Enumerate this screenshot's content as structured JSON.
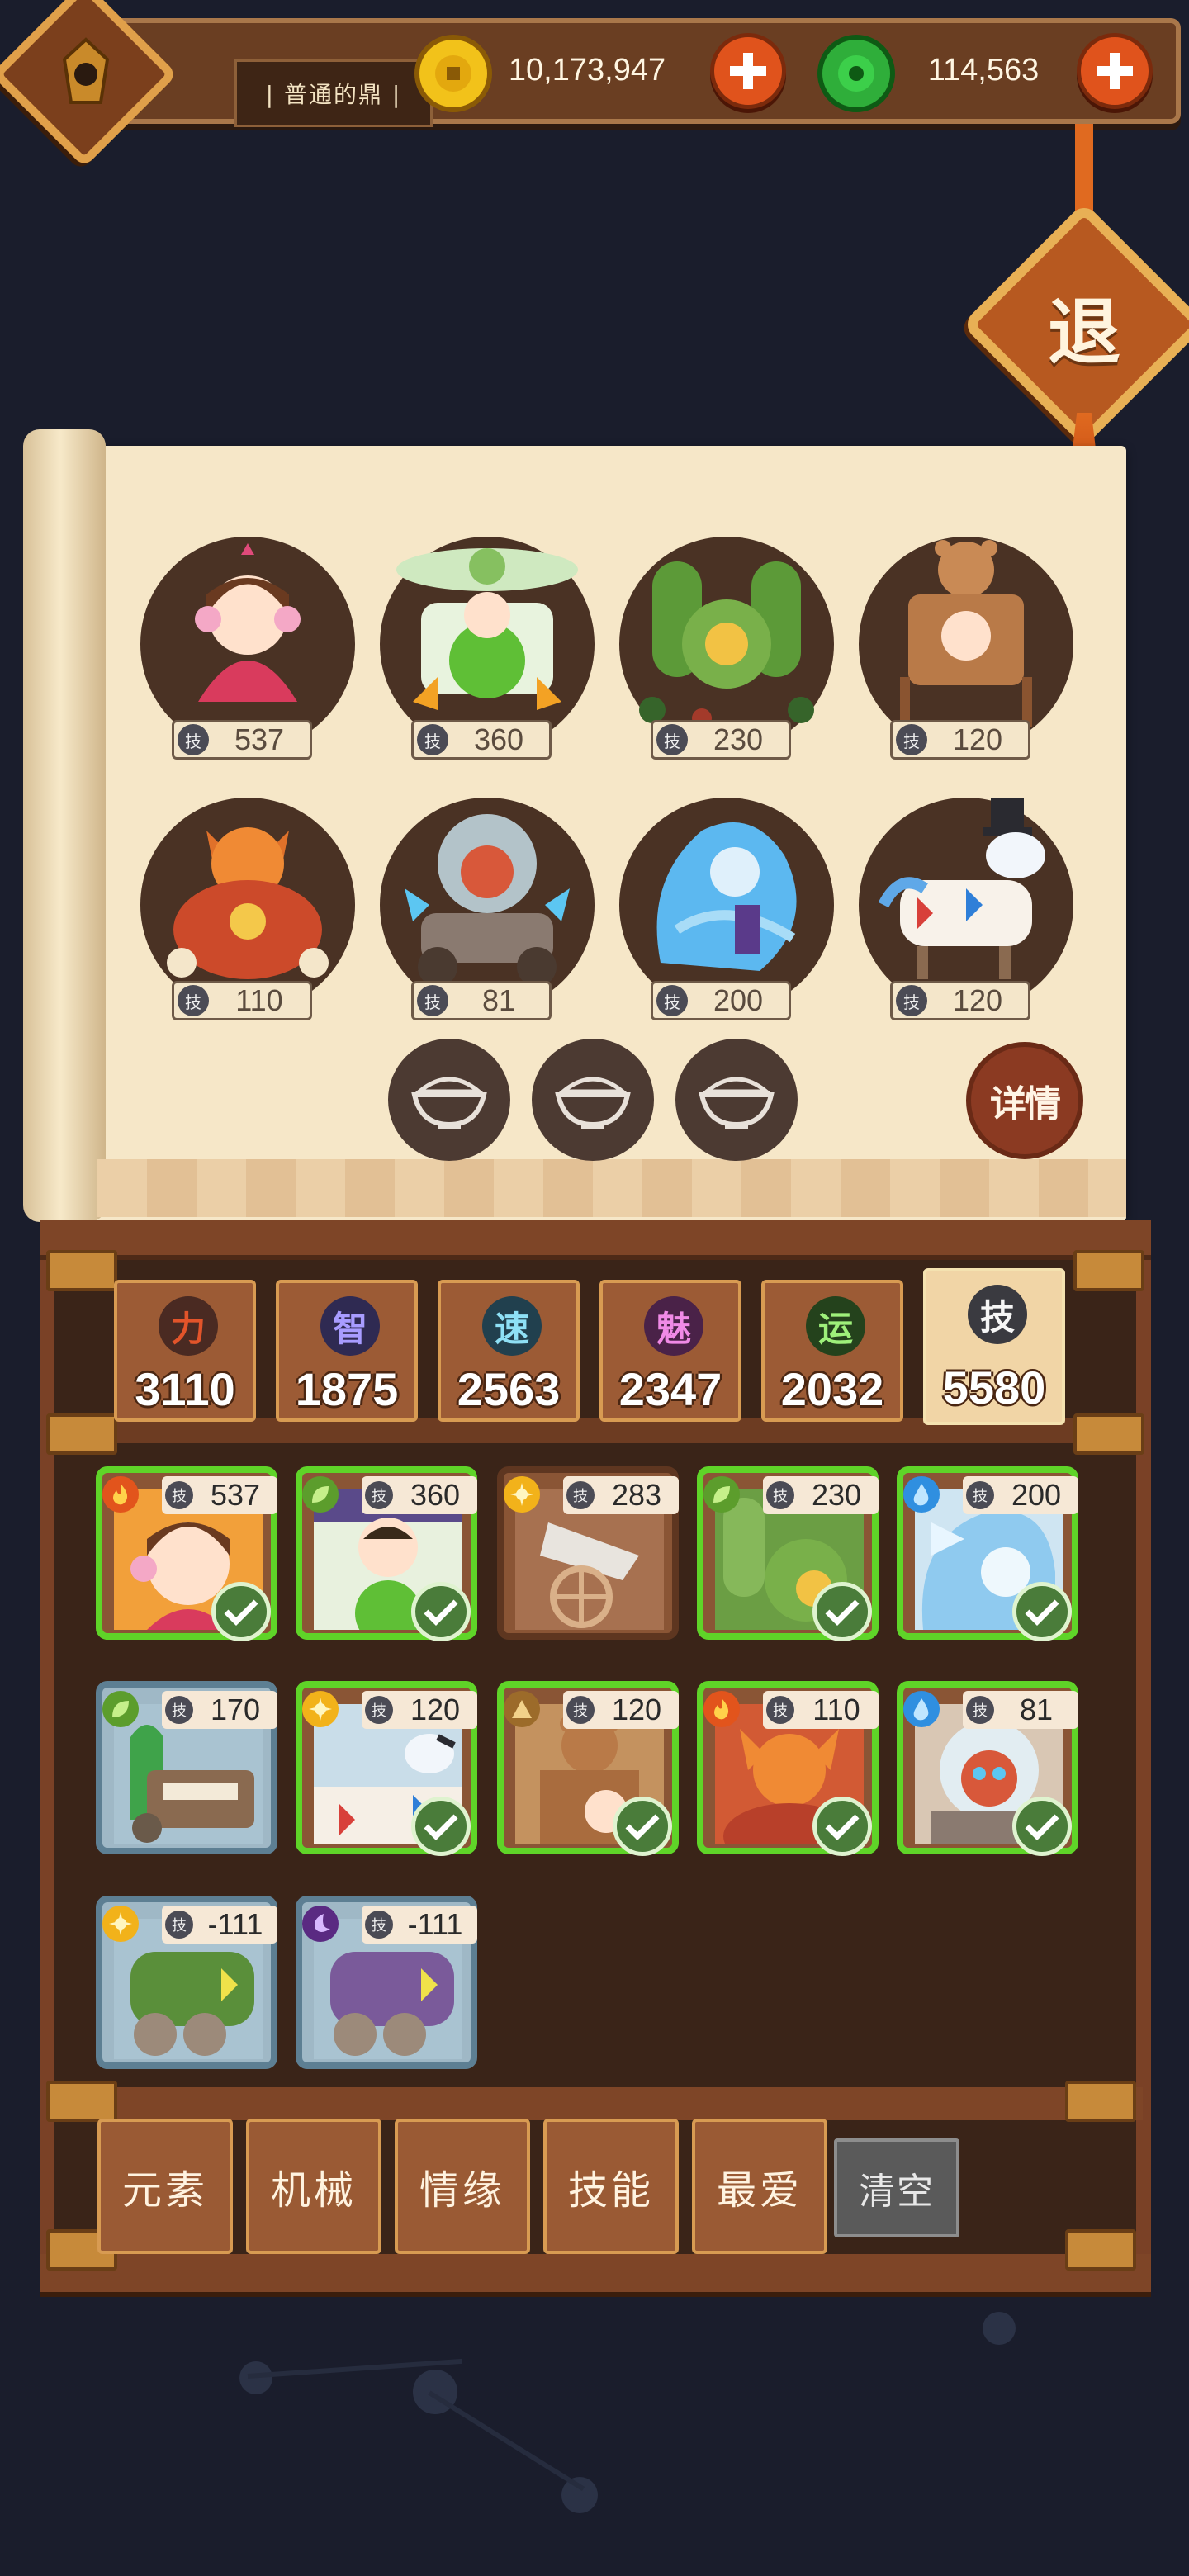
{
  "header": {
    "player_title": "| 普通的鼎 |",
    "gold_amount": "10,173,947",
    "jade_amount": "114,563"
  },
  "exit_label": "退",
  "team": [
    {
      "name": "pink-girl-hero",
      "skill": "537"
    },
    {
      "name": "green-mech-hero",
      "skill": "360"
    },
    {
      "name": "green-plant-mech",
      "skill": "230"
    },
    {
      "name": "bear-mech",
      "skill": "120"
    },
    {
      "name": "fox-general",
      "skill": "110"
    },
    {
      "name": "mouse-car",
      "skill": "81"
    },
    {
      "name": "water-spirit",
      "skill": "200"
    },
    {
      "name": "circus-horse",
      "skill": "120"
    }
  ],
  "skill_glyph": "技",
  "detail_label": "详情",
  "attributes": [
    {
      "glyph": "力",
      "value": "3110",
      "color": "#e2542a"
    },
    {
      "glyph": "智",
      "value": "1875",
      "color": "#7a6cf0"
    },
    {
      "glyph": "速",
      "value": "2563",
      "color": "#66cfe8"
    },
    {
      "glyph": "魅",
      "value": "2347",
      "color": "#e56ad9"
    },
    {
      "glyph": "运",
      "value": "2032",
      "color": "#7fe060"
    },
    {
      "glyph": "技",
      "value": "5580",
      "color": "#f6f6f6"
    }
  ],
  "roster": [
    {
      "element": "fire",
      "skill": "537",
      "selected": true
    },
    {
      "element": "leaf",
      "skill": "360",
      "selected": true
    },
    {
      "element": "light",
      "skill": "283",
      "selected": false
    },
    {
      "element": "leaf",
      "skill": "230",
      "selected": true
    },
    {
      "element": "water",
      "skill": "200",
      "selected": true
    },
    {
      "element": "leaf",
      "skill": "170",
      "selected": false
    },
    {
      "element": "light",
      "skill": "120",
      "selected": true
    },
    {
      "element": "earth",
      "skill": "120",
      "selected": true
    },
    {
      "element": "fire",
      "skill": "110",
      "selected": true
    },
    {
      "element": "water",
      "skill": "81",
      "selected": true
    },
    {
      "element": "light",
      "skill": "-111",
      "selected": false
    },
    {
      "element": "dark",
      "skill": "-111",
      "selected": false
    }
  ],
  "filters": [
    "元素",
    "机械",
    "情缘",
    "技能",
    "最爱"
  ],
  "clear_label": "清空",
  "colors": {
    "fire": "#e2541c",
    "leaf": "#5c9d2c",
    "light": "#f2b21a",
    "water": "#2f8fe0",
    "earth": "#9c6b2a",
    "dark": "#5a2a82",
    "select_border": "#5fd428"
  }
}
